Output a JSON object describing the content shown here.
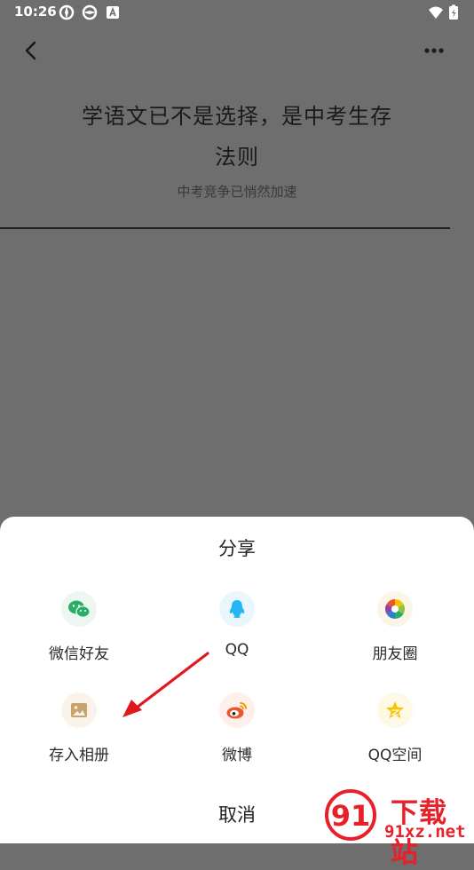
{
  "status_bar": {
    "time": "10:26",
    "icons": [
      "app-notification-icon",
      "app-notification-icon",
      "font-a-icon",
      "wifi-icon",
      "battery-charging-icon"
    ]
  },
  "nav": {
    "back_icon": "chevron-left-icon",
    "more_icon": "more-dots-icon"
  },
  "article": {
    "title_line1": "学语文已不是选择，是中考生存",
    "title_line2": "法则",
    "subtitle": "中考竞争已悄然加速"
  },
  "share_sheet": {
    "title": "分享",
    "items": [
      {
        "label": "微信好友",
        "icon": "wechat-icon",
        "color": "#2aae67"
      },
      {
        "label": "QQ",
        "icon": "qq-penguin-icon",
        "color": "#24b6f2"
      },
      {
        "label": "朋友圈",
        "icon": "moments-aperture-icon",
        "color": "#f39c12"
      },
      {
        "label": "存入相册",
        "icon": "photo-album-icon",
        "color": "#c8a36a"
      },
      {
        "label": "微博",
        "icon": "weibo-icon",
        "color": "#e8572d"
      },
      {
        "label": "QQ空间",
        "icon": "qzone-star-icon",
        "color": "#f5c400"
      }
    ],
    "cancel_label": "取消"
  },
  "annotation": {
    "color": "#e0191e"
  },
  "watermark": {
    "logo_text": "91",
    "text_top": "下载站",
    "text_bottom": "91xz.net"
  }
}
